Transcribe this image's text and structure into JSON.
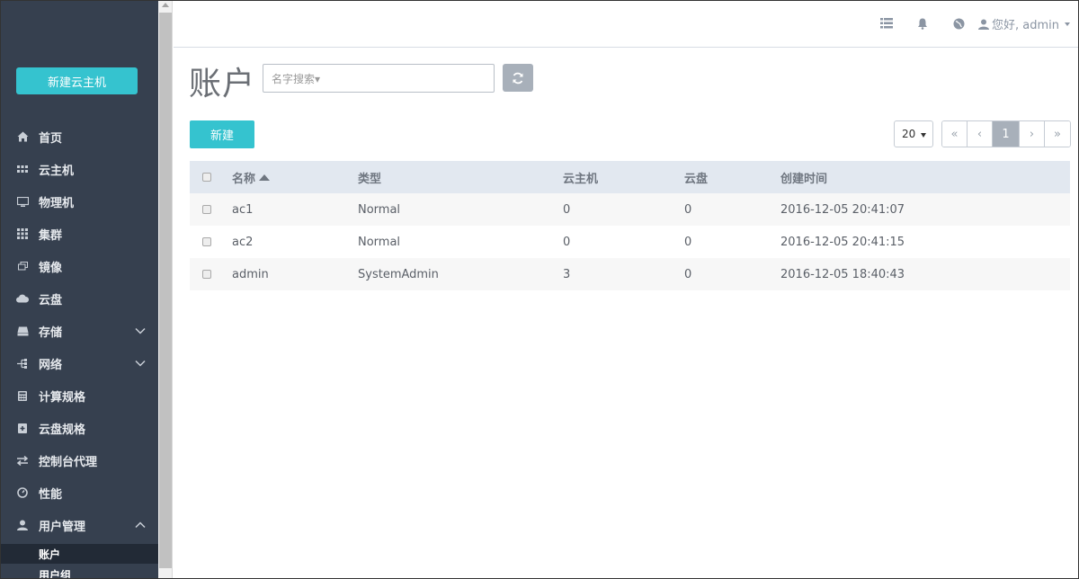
{
  "sidebar": {
    "new_vm_label": "新建云主机",
    "items": [
      {
        "label": "首页",
        "icon": "home-icon"
      },
      {
        "label": "云主机",
        "icon": "vm-icon"
      },
      {
        "label": "物理机",
        "icon": "monitor-icon"
      },
      {
        "label": "集群",
        "icon": "grid-icon"
      },
      {
        "label": "镜像",
        "icon": "image-icon"
      },
      {
        "label": "云盘",
        "icon": "cloud-icon"
      },
      {
        "label": "存储",
        "icon": "storage-icon"
      },
      {
        "label": "网络",
        "icon": "network-icon"
      },
      {
        "label": "计算规格",
        "icon": "calculator-icon"
      },
      {
        "label": "云盘规格",
        "icon": "disk-plus-icon"
      },
      {
        "label": "控制台代理",
        "icon": "exchange-icon"
      },
      {
        "label": "性能",
        "icon": "dashboard-icon"
      },
      {
        "label": "用户管理",
        "icon": "user-icon"
      }
    ],
    "sub_items": [
      {
        "label": "账户",
        "active": true
      },
      {
        "label": "用户组",
        "active": false
      }
    ]
  },
  "header": {
    "user_greeting": "您好, admin"
  },
  "main": {
    "title": "账户",
    "search_placeholder": "名字搜索▾",
    "create_label": "新建",
    "page_size": "20",
    "pager": {
      "first": "«",
      "prev": "‹",
      "current": "1",
      "next": "›",
      "last": "»"
    }
  },
  "table": {
    "columns": [
      "名称",
      "类型",
      "云主机",
      "云盘",
      "创建时间"
    ],
    "rows": [
      {
        "name": "ac1",
        "type": "Normal",
        "vms": "0",
        "disks": "0",
        "created": "2016-12-05 20:41:07"
      },
      {
        "name": "ac2",
        "type": "Normal",
        "vms": "0",
        "disks": "0",
        "created": "2016-12-05 20:41:15"
      },
      {
        "name": "admin",
        "type": "SystemAdmin",
        "vms": "3",
        "disks": "0",
        "created": "2016-12-05 18:40:43"
      }
    ]
  },
  "colors": {
    "accent": "#35c3cf",
    "sidebar_bg": "#36404f",
    "table_header_bg": "#e2e8f0"
  }
}
